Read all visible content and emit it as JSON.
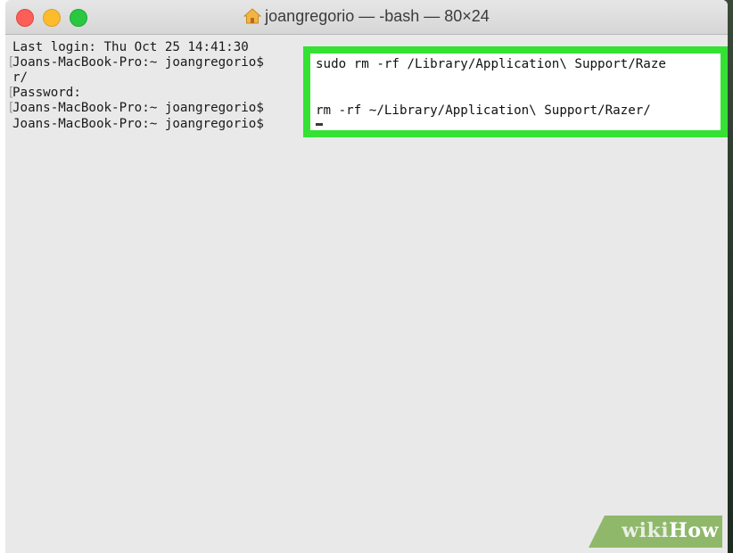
{
  "window": {
    "title": "joangregorio — -bash — 80×24",
    "title_icon": "home-icon",
    "traffic_lights": {
      "close": "#fc5f57",
      "minimize": "#fdbc2e",
      "maximize": "#29c840"
    }
  },
  "terminal": {
    "background": "#e9e9e9",
    "lines": [
      "Last login: Thu Oct 25 14:41:30",
      "Joans-MacBook-Pro:~ joangregorio$",
      "r/",
      "Password:",
      "Joans-MacBook-Pro:~ joangregorio$",
      "Joans-MacBook-Pro:~ joangregorio$"
    ]
  },
  "highlight": {
    "border_color": "#34e234",
    "command_1": "sudo rm -rf /Library/Application\\ Support/Raze",
    "command_2": "rm -rf ~/Library/Application\\ Support/Razer/"
  },
  "watermark": {
    "part1": "wiki",
    "part2": "How"
  }
}
